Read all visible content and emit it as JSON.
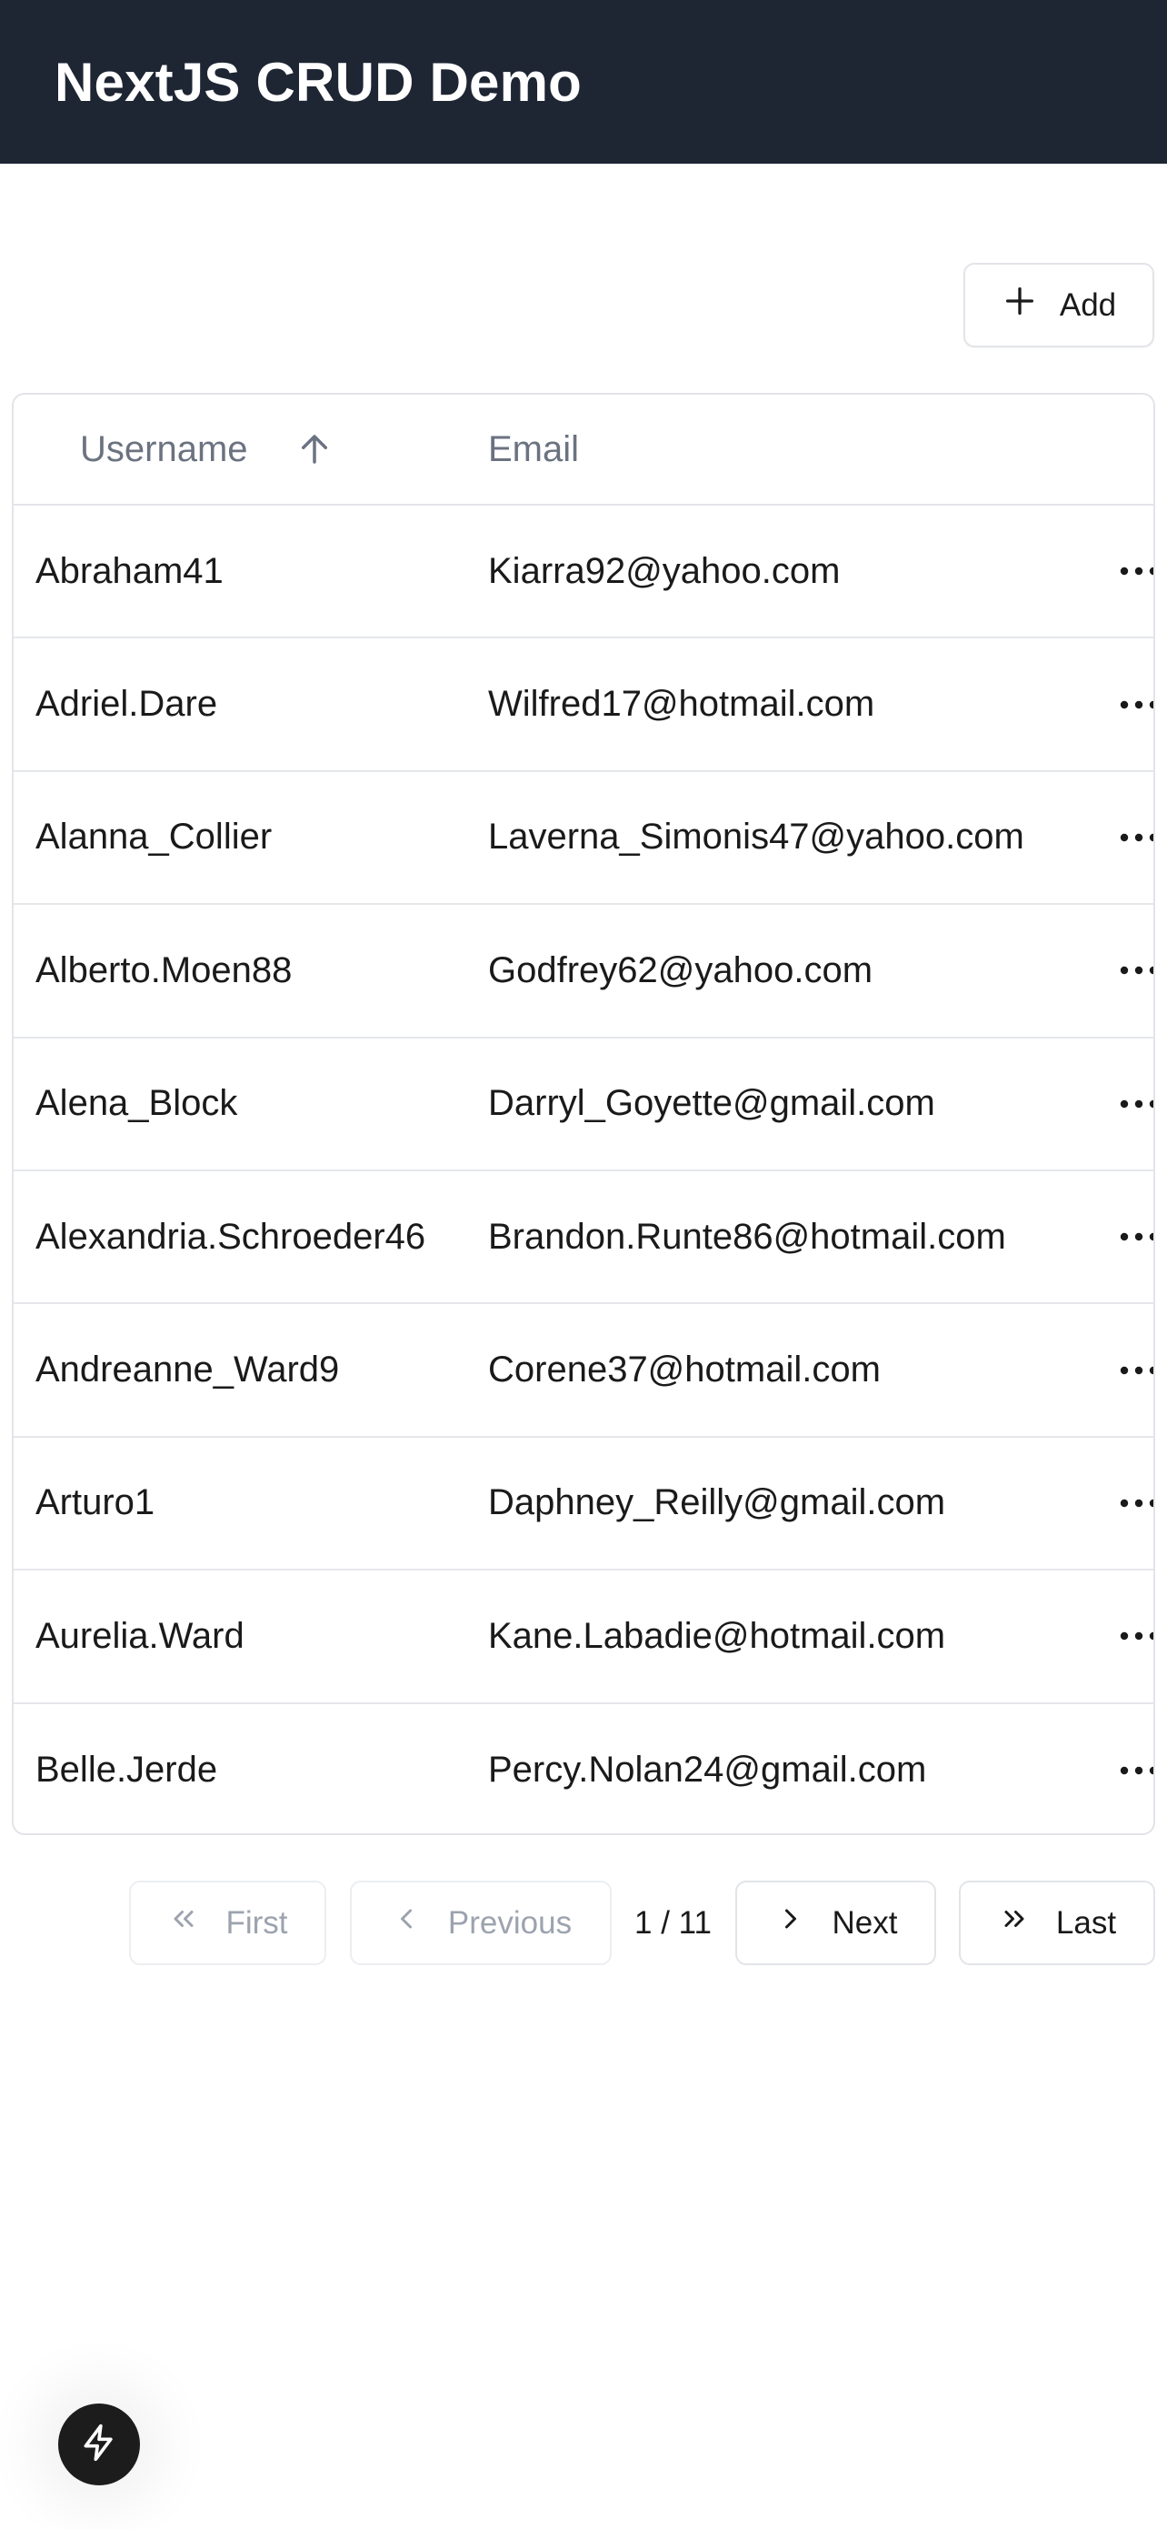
{
  "header": {
    "title": "NextJS CRUD Demo"
  },
  "toolbar": {
    "add_label": "Add",
    "add_icon": "plus-icon"
  },
  "table": {
    "columns": [
      {
        "label": "Username",
        "sort": "ascending"
      },
      {
        "label": "Email"
      }
    ],
    "rows": [
      {
        "username": "Abraham41",
        "email": "Kiarra92@yahoo.com"
      },
      {
        "username": "Adriel.Dare",
        "email": "Wilfred17@hotmail.com"
      },
      {
        "username": "Alanna_Collier",
        "email": "Laverna_Simonis47@yahoo.com"
      },
      {
        "username": "Alberto.Moen88",
        "email": "Godfrey62@yahoo.com"
      },
      {
        "username": "Alena_Block",
        "email": "Darryl_Goyette@gmail.com"
      },
      {
        "username": "Alexandria.Schroeder46",
        "email": "Brandon.Runte86@hotmail.com"
      },
      {
        "username": "Andreanne_Ward9",
        "email": "Corene37@hotmail.com"
      },
      {
        "username": "Arturo1",
        "email": "Daphney_Reilly@gmail.com"
      },
      {
        "username": "Aurelia.Ward",
        "email": "Kane.Labadie@hotmail.com"
      },
      {
        "username": "Belle.Jerde",
        "email": "Percy.Nolan24@gmail.com"
      }
    ]
  },
  "pagination": {
    "first_label": "First",
    "previous_label": "Previous",
    "page_indicator": "1 / 11",
    "next_label": "Next",
    "last_label": "Last",
    "current_page": 1,
    "total_pages": 11
  },
  "colors": {
    "header_bg": "#1e2533",
    "border": "#e2e4e8",
    "muted_text": "#6b7280",
    "disabled_text": "#9ca3af"
  }
}
